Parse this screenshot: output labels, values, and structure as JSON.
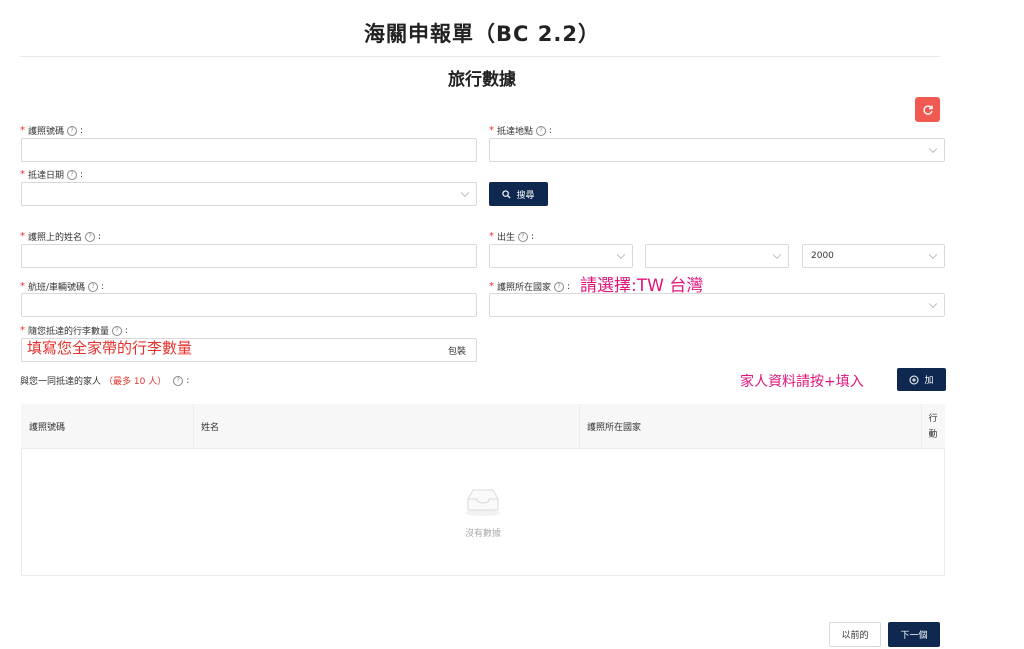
{
  "page": {
    "title": "海關申報單（BC 2.2）",
    "section_title": "旅行數據"
  },
  "form": {
    "passport_number": {
      "label": "護照號碼",
      "value": ""
    },
    "arrival_place": {
      "label": "抵達地點",
      "value": ""
    },
    "arrival_date": {
      "label": "抵達日期",
      "value": ""
    },
    "search_button": "搜尋",
    "passport_name": {
      "label": "護照上的姓名",
      "value": ""
    },
    "birth": {
      "label": "出生",
      "day": "",
      "month": "",
      "year": "2000"
    },
    "flight_number": {
      "label": "航班/車輛號碼",
      "value": ""
    },
    "passport_country": {
      "label": "護照所在國家",
      "value": ""
    },
    "baggage_count": {
      "label": "隨您抵達的行李數量",
      "value": "",
      "unit": "包裝"
    },
    "family": {
      "label_prefix": "與您一同抵達的家人",
      "label_limit": "（最多 10 人）",
      "add_button": "加"
    }
  },
  "annotations": {
    "country_hint": "請選擇:TW 台灣",
    "baggage_hint": "填寫您全家帶的行李數量",
    "family_hint": "家人資料請按+填入"
  },
  "table": {
    "columns": [
      "護照號碼",
      "姓名",
      "護照所在國家",
      "行動"
    ],
    "empty_text": "沒有數據"
  },
  "footer": {
    "prev_button": "以前的",
    "next_button": "下一個"
  },
  "colors": {
    "primary": "#0f2850",
    "reset": "#f05a50",
    "required": "#e5322d",
    "annotation_pink": "#e0157c"
  }
}
